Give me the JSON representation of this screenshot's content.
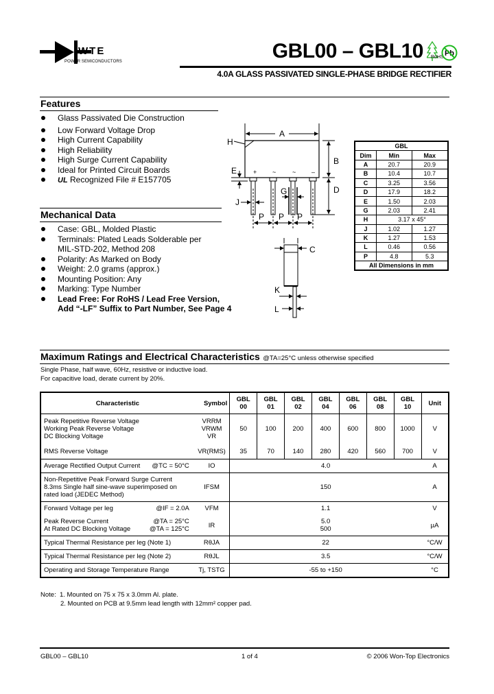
{
  "header": {
    "logo_brand": "WTE",
    "logo_tagline": "POWER SEMICONDUCTORS",
    "title": "GBL00 – GBL10",
    "rohs_label": "RoHS",
    "pb_label": "Pb",
    "subtitle": "4.0A GLASS PASSIVATED SINGLE-PHASE BRIDGE RECTIFIER"
  },
  "features": {
    "title": "Features",
    "items": [
      "Glass Passivated Die Construction",
      "Low Forward Voltage Drop",
      "High Current Capability",
      "High Reliability",
      "High Surge Current Capability",
      "Ideal for Printed Circuit Boards",
      "Recognized File # E157705"
    ],
    "ul_mark": "UL"
  },
  "mechanical": {
    "title": "Mechanical Data",
    "items": [
      "Case: GBL, Molded Plastic",
      "Terminals: Plated Leads Solderable per",
      "MIL-STD-202, Method 208",
      "Polarity: As Marked on Body",
      "Weight: 2.0 grams (approx.)",
      "Mounting Position: Any",
      "Marking: Type Number",
      "Lead Free: For RoHS / Lead Free Version,",
      "Add “-LF” Suffix to Part Number, See Page 4"
    ]
  },
  "diagram": {
    "labels": {
      "A": "A",
      "B": "B",
      "C": "C",
      "D": "D",
      "E": "E",
      "G": "G",
      "H": "H",
      "J": "J",
      "K": "K",
      "L": "L",
      "P": "P"
    },
    "pin_marks": [
      "+",
      "~",
      "~",
      "–"
    ]
  },
  "dimensions": {
    "package": "GBL",
    "headers": [
      "Dim",
      "Min",
      "Max"
    ],
    "rows": [
      {
        "dim": "A",
        "min": "20.7",
        "max": "20.9"
      },
      {
        "dim": "B",
        "min": "10.4",
        "max": "10.7"
      },
      {
        "dim": "C",
        "min": "3.25",
        "max": "3.56"
      },
      {
        "dim": "D",
        "min": "17.9",
        "max": "18.2"
      },
      {
        "dim": "E",
        "min": "1.50",
        "max": "2.03"
      },
      {
        "dim": "G",
        "min": "2.03",
        "max": "2.41"
      },
      {
        "dim": "H",
        "span": "3.17 x 45°"
      },
      {
        "dim": "J",
        "min": "1.02",
        "max": "1.27"
      },
      {
        "dim": "K",
        "min": "1.27",
        "max": "1.53"
      },
      {
        "dim": "L",
        "min": "0.46",
        "max": "0.56"
      },
      {
        "dim": "P",
        "min": "4.8",
        "max": "5.3"
      }
    ],
    "footer": "All Dimensions in mm"
  },
  "ratings": {
    "title": "Maximum Ratings and Electrical Characteristics",
    "condition": "@TA=25°C unless otherwise specified",
    "notes": [
      "Single Phase, half wave, 60Hz, resistive or inductive load.",
      "For capacitive load, derate current by 20%."
    ],
    "headers": {
      "characteristic": "Characteristic",
      "symbol": "Symbol",
      "parts": [
        [
          "GBL",
          "00"
        ],
        [
          "GBL",
          "01"
        ],
        [
          "GBL",
          "02"
        ],
        [
          "GBL",
          "04"
        ],
        [
          "GBL",
          "06"
        ],
        [
          "GBL",
          "08"
        ],
        [
          "GBL",
          "10"
        ]
      ],
      "unit": "Unit"
    },
    "rows": [
      {
        "chars": [
          "Peak Repetitive Reverse Voltage",
          "Working Peak Reverse Voltage",
          "DC Blocking Voltage"
        ],
        "symbols": [
          "VRRM",
          "VRWM",
          "VR"
        ],
        "values": [
          "50",
          "100",
          "200",
          "400",
          "600",
          "800",
          "1000"
        ],
        "unit": "V"
      },
      {
        "chars": [
          "RMS Reverse Voltage"
        ],
        "symbols": [
          "VR(RMS)"
        ],
        "values": [
          "35",
          "70",
          "140",
          "280",
          "420",
          "560",
          "700"
        ],
        "unit": "V"
      },
      {
        "chars": [
          "Average Rectified Output Current"
        ],
        "cond": "@TC = 50°C",
        "symbols": [
          "IO"
        ],
        "value": "4.0",
        "unit": "A"
      },
      {
        "chars": [
          "Non-Repetitive Peak Forward Surge Current",
          "8.3ms Single half sine-wave superimposed on",
          "rated load (JEDEC Method)"
        ],
        "symbols": [
          "IFSM"
        ],
        "value": "150",
        "unit": "A"
      },
      {
        "chars": [
          "Forward Voltage per leg"
        ],
        "cond": "@IF = 2.0A",
        "symbols": [
          "VFM"
        ],
        "value": "1.1",
        "unit": "V"
      },
      {
        "chars": [
          "Peak Reverse Current",
          "At Rated DC Blocking Voltage"
        ],
        "conds": [
          "@TA = 25°C",
          "@TA = 125°C"
        ],
        "symbols": [
          "IR"
        ],
        "values2": [
          "5.0",
          "500"
        ],
        "unit": "µA"
      },
      {
        "chars": [
          "Typical Thermal Resistance per leg (Note 1)"
        ],
        "symbols": [
          "RθJA"
        ],
        "value": "22",
        "unit": "°C/W"
      },
      {
        "chars": [
          "Typical Thermal Resistance per leg (Note 2)"
        ],
        "symbols": [
          "RθJL"
        ],
        "value": "3.5",
        "unit": "°C/W"
      },
      {
        "chars": [
          "Operating and Storage Temperature Range"
        ],
        "symbols": [
          "Tj, TSTG"
        ],
        "value": "-55 to +150",
        "unit": "°C"
      }
    ]
  },
  "footnotes": {
    "label": "Note:",
    "items": [
      "1. Mounted on 75 x 75 x 3.0mm Al. plate.",
      "2. Mounted on PCB at 9.5mm lead length with 12mm² copper pad."
    ]
  },
  "footer": {
    "left": "GBL00 – GBL10",
    "middle": "1 of 4",
    "right": "© 2006 Won-Top Electronics"
  }
}
